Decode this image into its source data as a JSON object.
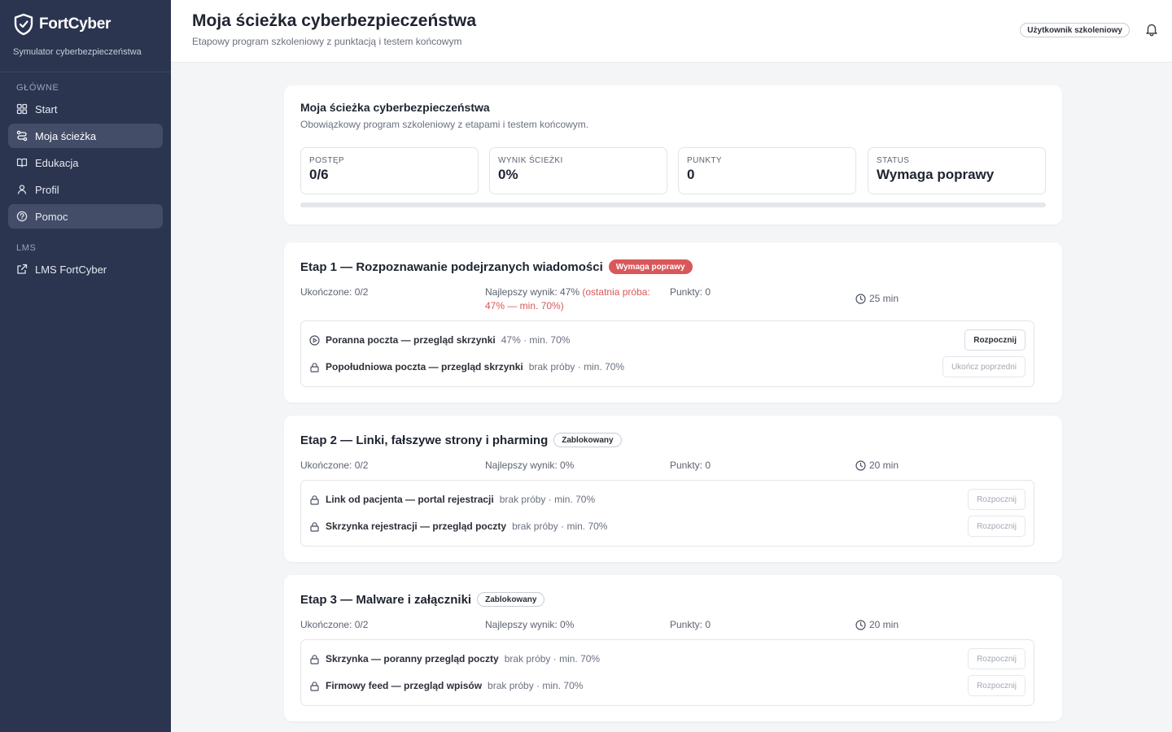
{
  "app": {
    "brand_name": "FortCyber",
    "brand_sub": "Symulator cyberbezpieczeństwa"
  },
  "sidebar": {
    "section_main": "GŁÓWNE",
    "items": [
      {
        "label": "Start",
        "icon": "grid-icon"
      },
      {
        "label": "Moja ścieżka",
        "icon": "route-icon"
      },
      {
        "label": "Edukacja",
        "icon": "book-icon"
      },
      {
        "label": "Profil",
        "icon": "user-icon"
      },
      {
        "label": "Pomoc",
        "icon": "help-circle-icon"
      }
    ],
    "section_lms": "LMS",
    "lms_item": {
      "label": "LMS FortCyber",
      "icon": "external-link-icon"
    }
  },
  "header": {
    "title": "Moja ścieżka cyberbezpieczeństwa",
    "subtitle": "Etapowy program szkoleniowy z punktacją i testem końcowym",
    "user_badge": "Użytkownik szkoleniowy"
  },
  "summary": {
    "title": "Moja ścieżka cyberbezpieczeństwa",
    "subtitle": "Obowiązkowy program szkoleniowy z etapami i testem końcowym.",
    "stats": [
      {
        "label": "POSTĘP",
        "value": "0/6"
      },
      {
        "label": "WYNIK ŚCIEŻKI",
        "value": "0%"
      },
      {
        "label": "PUNKTY",
        "value": "0"
      },
      {
        "label": "STATUS",
        "value": "Wymaga poprawy"
      }
    ],
    "progress_fraction": 0
  },
  "stages": [
    {
      "title": "Etap 1 — Rozpoznawanie podejrzanych wiadomości",
      "badge": "Wymaga poprawy",
      "completed": "Ukończone: 0/2",
      "best_prefix": "Najlepszy wynik: 47% ",
      "best_warn": "(ostatnia próba: 47% — min. 70%)",
      "points": "Punkty: 0",
      "time": "25 min",
      "lessons": [
        {
          "icon": "play-circle-icon",
          "name": "Poranna poczta — przegląd skrzynki",
          "meta": "47% · min. 70%",
          "button": "Rozpocznij"
        },
        {
          "icon": "lock-icon",
          "name": "Popołudniowa poczta — przegląd skrzynki",
          "meta": "brak próby · min. 70%",
          "button": "Ukończ poprzedni"
        }
      ]
    },
    {
      "title": "Etap 2 — Linki, fałszywe strony i pharming",
      "badge": "Zablokowany",
      "completed": "Ukończone: 0/2",
      "best_prefix": "Najlepszy wynik: 0%",
      "points": "Punkty: 0",
      "time": "20 min",
      "lessons": [
        {
          "icon": "lock-icon",
          "name": "Link od pacjenta — portal rejestracji",
          "meta": "brak próby · min. 70%",
          "button": "Rozpocznij"
        },
        {
          "icon": "lock-icon",
          "name": "Skrzynka rejestracji — przegląd poczty",
          "meta": "brak próby · min. 70%",
          "button": "Rozpocznij"
        }
      ]
    },
    {
      "title": "Etap 3 — Malware i załączniki",
      "badge": "Zablokowany",
      "completed": "Ukończone: 0/2",
      "best_prefix": "Najlepszy wynik: 0%",
      "points": "Punkty: 0",
      "time": "20 min",
      "lessons": [
        {
          "icon": "lock-icon",
          "name": "Skrzynka — poranny przegląd poczty",
          "meta": "brak próby · min. 70%",
          "button": "Rozpocznij"
        },
        {
          "icon": "lock-icon",
          "name": "Firmowy feed — przegląd wpisów",
          "meta": "brak próby · min. 70%",
          "button": "Rozpocznij"
        }
      ]
    }
  ],
  "colors": {
    "sidebar_bg": "#2b3550",
    "accent_red": "#d9575a",
    "page_bg": "#f4f5f7"
  }
}
